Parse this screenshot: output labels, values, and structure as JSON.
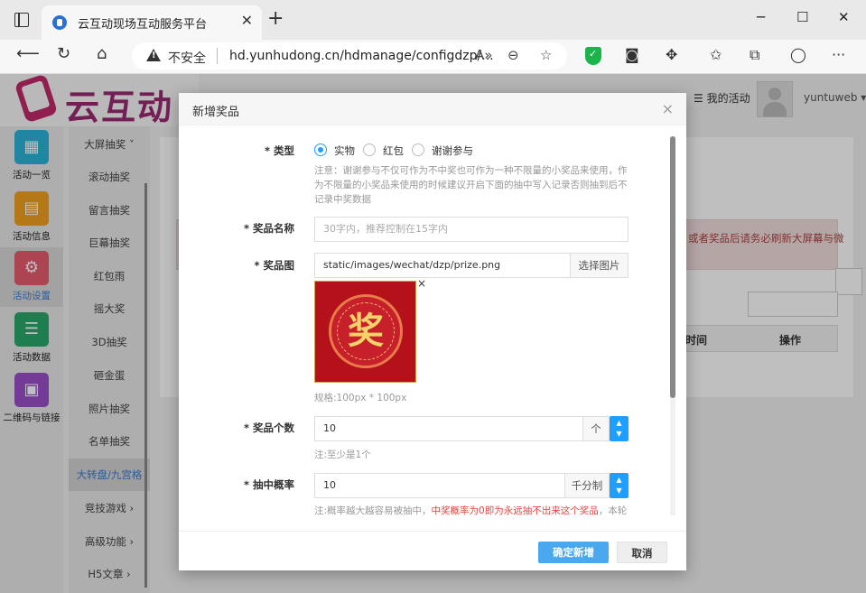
{
  "browser": {
    "tab_title": "云互动现场互动服务平台",
    "tab_close": "✕",
    "new_tab": "+",
    "win_min": "─",
    "win_max": "☐",
    "win_close": "✕",
    "insecure_label": "不安全",
    "url": "hd.yunhudong.cn/hdmanage/configdzp/..."
  },
  "header": {
    "logo_text": "云互动",
    "my_activity": "☰ 我的活动",
    "username": "yuntuweb ▾"
  },
  "sidebar": {
    "items": [
      {
        "label": "活动一览",
        "color": "#2bb3d9",
        "icon": "grid-icon"
      },
      {
        "label": "活动信息",
        "color": "#f0a21e",
        "icon": "document-icon"
      },
      {
        "label": "活动设置",
        "color": "#e65b6e",
        "icon": "gear-icon"
      },
      {
        "label": "活动数据",
        "color": "#2aa86a",
        "icon": "database-icon"
      },
      {
        "label": "二维码与链接",
        "color": "#9a4ec9",
        "icon": "qrcode-icon"
      }
    ]
  },
  "subnav": {
    "items": [
      "大屏抽奖 ˅",
      "滚动抽奖",
      "留言抽奖",
      "巨幕抽奖",
      "红包雨",
      "摇大奖",
      "3D抽奖",
      "砸金蛋",
      "照片抽奖",
      "名单抽奖",
      "大转盘/九宫格",
      "竞技游戏 ›",
      "高级功能 ›",
      "H5文章 ›"
    ]
  },
  "background": {
    "alert_text": "或者奖品后请务必刷新大屏幕与微",
    "table_col_time": "时间",
    "table_col_action": "操作"
  },
  "modal": {
    "title": "新增奖品",
    "close": "×",
    "type": {
      "label": "* 类型",
      "options": [
        "实物",
        "红包",
        "谢谢参与"
      ],
      "selected": "实物",
      "hint": "注意：谢谢参与不仅可作为不中奖也可作为一种不限量的小奖品来使用，作为不限量的小奖品来使用的时候建议开启下面的抽中写入记录否则抽到后不记录中奖数据"
    },
    "name": {
      "label": "* 奖品名称",
      "placeholder": "30字内，推荐控制在15字内"
    },
    "image": {
      "label": "* 奖品图",
      "value": "static/images/wechat/dzp/prize.png",
      "button": "选择图片",
      "preview_char": "奖",
      "remove": "×",
      "spec": "规格:100px * 100px"
    },
    "count": {
      "label": "* 奖品个数",
      "value": "10",
      "unit": "个",
      "hint": "注:至少是1个"
    },
    "probability": {
      "label": "* 抽中概率",
      "value": "10",
      "unit": "千分制",
      "hint_prefix": "注:概率越大越容易被抽中，",
      "hint_warning": "中奖概率为0即为永远抽不出来这个奖品",
      "hint_suffix": "，本轮"
    },
    "confirm": "确定新增",
    "cancel": "取消"
  }
}
